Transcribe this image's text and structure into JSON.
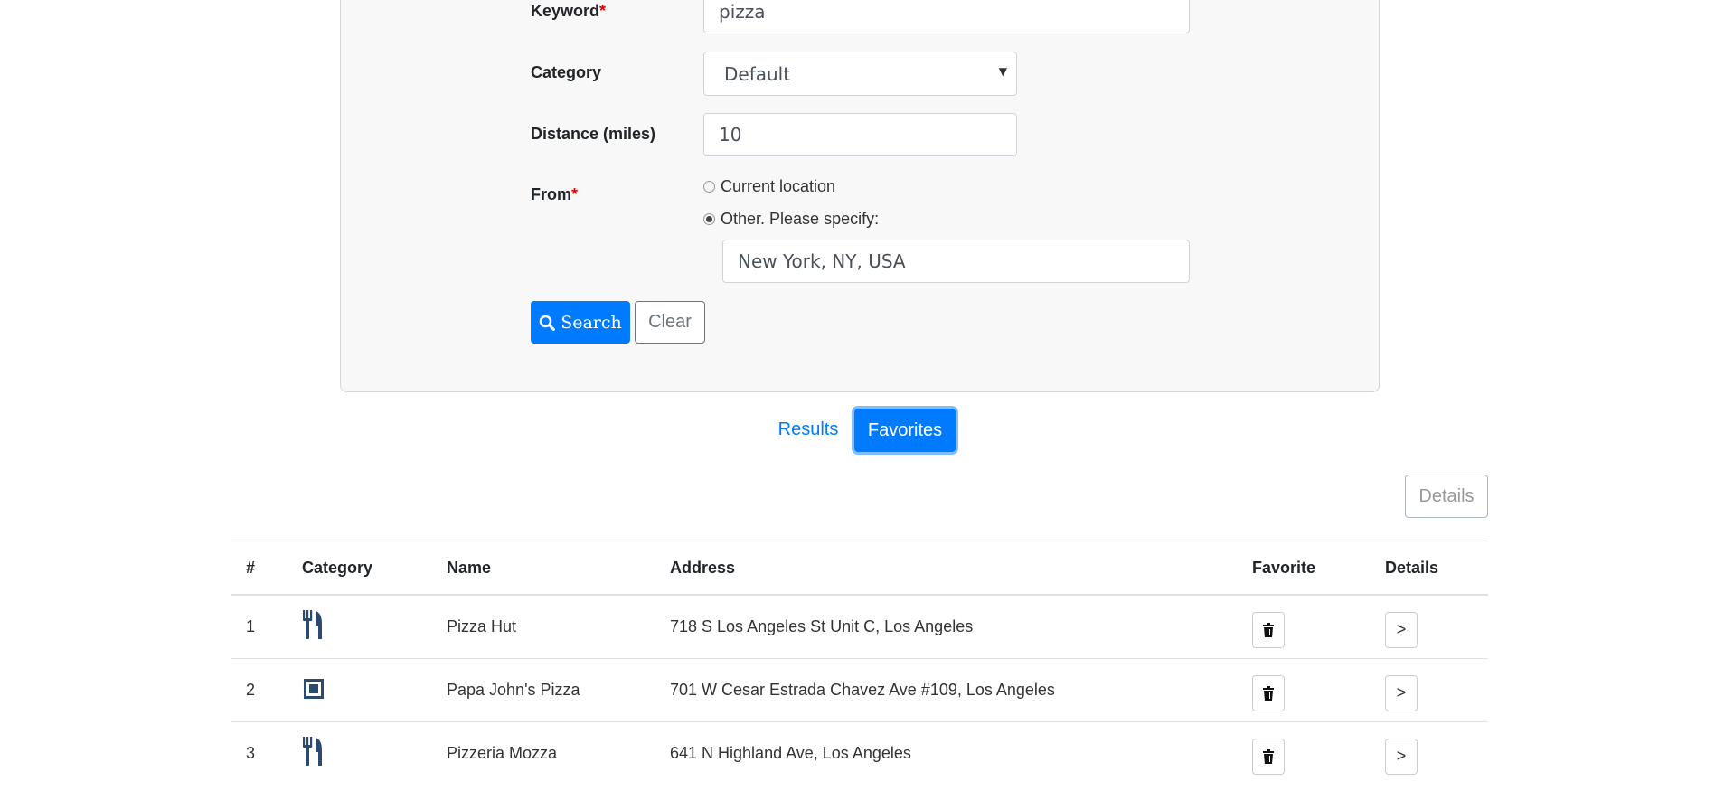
{
  "form": {
    "keyword_label": "Keyword",
    "keyword_required": "*",
    "keyword_value": "pizza",
    "category_label": "Category",
    "category_value": "Default",
    "distance_label": "Distance (miles)",
    "distance_value": "10",
    "from_label": "From",
    "from_required": "*",
    "radio_current": "Current location",
    "radio_other": "Other. Please specify:",
    "location_value": "New York, NY, USA",
    "search_label": "Search",
    "clear_label": "Clear"
  },
  "tabs": {
    "results": "Results",
    "favorites": "Favorites"
  },
  "details_top_label": "Details",
  "table": {
    "headers": [
      "#",
      "Category",
      "Name",
      "Address",
      "Favorite",
      "Details"
    ],
    "rows": [
      {
        "num": "1",
        "icon": "restaurant-icon",
        "name": "Pizza Hut",
        "address": "718 S Los Angeles St Unit C, Los Angeles",
        "details": ">"
      },
      {
        "num": "2",
        "icon": "store-icon",
        "name": "Papa John's Pizza",
        "address": "701 W Cesar Estrada Chavez Ave #109, Los Angeles",
        "details": ">"
      },
      {
        "num": "3",
        "icon": "restaurant-icon",
        "name": "Pizzeria Mozza",
        "address": "641 N Highland Ave, Los Angeles",
        "details": ">"
      }
    ]
  },
  "colors": {
    "primary": "#007bff",
    "icon": "#2c4a6e",
    "required": "#e00000"
  }
}
